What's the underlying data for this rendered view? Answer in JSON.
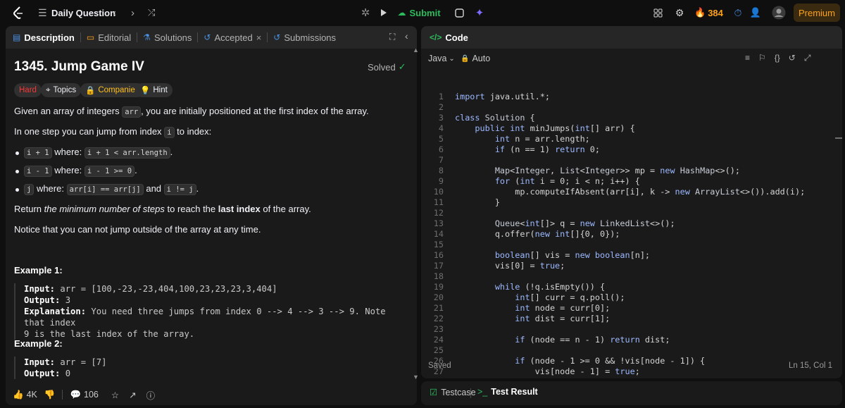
{
  "topbar": {
    "daily_question": "Daily Question",
    "submit": "Submit",
    "streak": "384",
    "premium": "Premium"
  },
  "tabs": {
    "description": "Description",
    "editorial": "Editorial",
    "solutions": "Solutions",
    "accepted": "Accepted",
    "submissions": "Submissions"
  },
  "problem": {
    "title": "1345. Jump Game IV",
    "solved": "Solved",
    "difficulty": "Hard",
    "topics": "Topics",
    "companies": "Companies",
    "hint": "Hint",
    "p1a": "Given an array of integers ",
    "p1code": "arr",
    "p1b": ", you are initially positioned at the first index of the array.",
    "p2a": "In one step you can jump from index ",
    "p2code": "i",
    "p2b": " to index:",
    "b1code1": "i + 1",
    "b1text": " where: ",
    "b1code2": "i + 1 < arr.length",
    "b1end": ".",
    "b2code1": "i - 1",
    "b2text": " where: ",
    "b2code2": "i - 1 >= 0",
    "b2end": ".",
    "b3code1": "j",
    "b3text": " where: ",
    "b3code2": "arr[i] == arr[j]",
    "b3and": " and ",
    "b3code3": "i != j",
    "b3end": ".",
    "p3a": "Return ",
    "p3em": "the minimum number of steps",
    "p3b": " to reach the ",
    "p3strong": "last index",
    "p3c": " of the array.",
    "p4": "Notice that you can not jump outside of the array at any time.",
    "ex1_title": "Example 1:",
    "ex1_input_label": "Input:",
    "ex1_input": " arr = [100,-23,-23,404,100,23,23,23,3,404]",
    "ex1_output_label": "Output:",
    "ex1_output": " 3",
    "ex1_expl_label": "Explanation:",
    "ex1_expl1": " You need three jumps from index 0 --> 4 --> 3 --> 9. Note that index",
    "ex1_expl2": "9 is the last index of the array.",
    "ex2_title": "Example 2:",
    "ex2_input_label": "Input:",
    "ex2_input": " arr = [7]",
    "ex2_output_label": "Output:",
    "ex2_output": " 0"
  },
  "footer_left": {
    "likes": "4K",
    "comments": "106"
  },
  "editor": {
    "code_tab": "Code",
    "language": "Java",
    "auto": "Auto",
    "saved": "Saved",
    "cursor": "Ln 15, Col 1",
    "testcase": "Testcase",
    "test_result": "Test Result",
    "lines": [
      "import java.util.*;",
      "",
      "class Solution {",
      "    public int minJumps(int[] arr) {",
      "        int n = arr.length;",
      "        if (n == 1) return 0;",
      "",
      "        Map<Integer, List<Integer>> mp = new HashMap<>();",
      "        for (int i = 0; i < n; i++) {",
      "            mp.computeIfAbsent(arr[i], k -> new ArrayList<>()).add(i);",
      "        }",
      "",
      "        Queue<int[]> q = new LinkedList<>();",
      "        q.offer(new int[]{0, 0});",
      "",
      "        boolean[] vis = new boolean[n];",
      "        vis[0] = true;",
      "",
      "        while (!q.isEmpty()) {",
      "            int[] curr = q.poll();",
      "            int node = curr[0];",
      "            int dist = curr[1];",
      "",
      "            if (node == n - 1) return dist;",
      "",
      "            if (node - 1 >= 0 && !vis[node - 1]) {",
      "                vis[node - 1] = true;"
    ],
    "line_numbers": [
      "1",
      "2",
      "3",
      "4",
      "5",
      "6",
      "7",
      "8",
      "9",
      "10",
      "11",
      "12",
      "13",
      "14",
      "15",
      "16",
      "17",
      "18",
      "19",
      "20",
      "21",
      "22",
      "23",
      "24",
      "25",
      "26",
      "27"
    ]
  },
  "colors": {
    "accent_green": "#2cbb5d",
    "hard_red": "#f63737",
    "premium_orange": "#ffa116",
    "companies_yellow": "#ffc01e",
    "link_blue": "#4a90e2"
  }
}
